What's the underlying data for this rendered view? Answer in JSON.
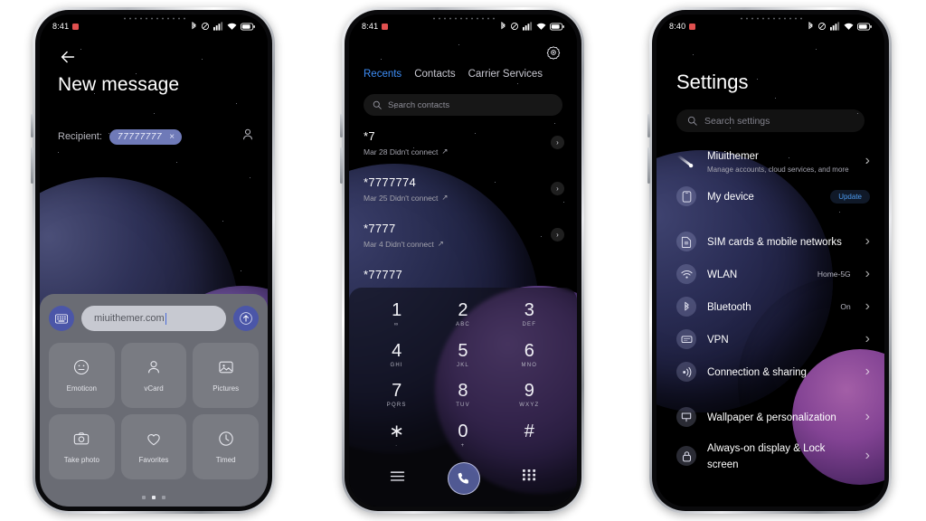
{
  "phones": [
    {
      "id": "new-message",
      "statusbar": {
        "time": "8:41",
        "icons": [
          "bluetooth-icon",
          "dnd-icon",
          "signal-icon",
          "wifi-icon",
          "battery-icon"
        ]
      },
      "screen": {
        "back_label": "Back",
        "title": "New message",
        "recipient_label": "Recipient:",
        "recipient_chip": "77777777",
        "chip_remove": "×",
        "contacts_icon": "person-icon",
        "composer": {
          "keyboard_icon": "keyboard-icon",
          "input_value": "miuithemer.com",
          "send_icon": "send-arrow-up-icon"
        },
        "attachments": [
          {
            "label": "Emoticon",
            "icon": "emoticon-icon"
          },
          {
            "label": "vCard",
            "icon": "person-icon"
          },
          {
            "label": "Pictures",
            "icon": "image-icon"
          },
          {
            "label": "Take photo",
            "icon": "camera-icon"
          },
          {
            "label": "Favorites",
            "icon": "heart-icon"
          },
          {
            "label": "Timed",
            "icon": "clock-icon"
          }
        ],
        "page_dots": {
          "count": 3,
          "active_index": 1
        }
      }
    },
    {
      "id": "dialer",
      "statusbar": {
        "time": "8:41",
        "icons": [
          "bluetooth-icon",
          "dnd-icon",
          "signal-icon",
          "wifi-icon",
          "battery-icon"
        ]
      },
      "screen": {
        "settings_icon": "gear-icon",
        "tabs": [
          {
            "label": "Recents",
            "active": true
          },
          {
            "label": "Contacts",
            "active": false
          },
          {
            "label": "Carrier Services",
            "active": false
          }
        ],
        "search_placeholder": "Search contacts",
        "search_icon": "search-icon",
        "calls": [
          {
            "number": "*7",
            "detail": "Mar 28 Didn't connect",
            "arrow": "↗"
          },
          {
            "number": "*7777774",
            "detail": "Mar 25 Didn't connect",
            "arrow": "↗"
          },
          {
            "number": "*7777",
            "detail": "Mar 4 Didn't connect",
            "arrow": "↗"
          },
          {
            "number": "*77777",
            "detail": "",
            "arrow": ""
          }
        ],
        "dialpad": [
          {
            "digit": "1",
            "letters": "∞"
          },
          {
            "digit": "2",
            "letters": "ABC"
          },
          {
            "digit": "3",
            "letters": "DEF"
          },
          {
            "digit": "4",
            "letters": "GHI"
          },
          {
            "digit": "5",
            "letters": "JKL"
          },
          {
            "digit": "6",
            "letters": "MNO"
          },
          {
            "digit": "7",
            "letters": "PQRS"
          },
          {
            "digit": "8",
            "letters": "TUV"
          },
          {
            "digit": "9",
            "letters": "WXYZ"
          },
          {
            "digit": "∗",
            "letters": "·"
          },
          {
            "digit": "0",
            "letters": "+"
          },
          {
            "digit": "#",
            "letters": ""
          }
        ],
        "bottombar": {
          "menu_icon": "hamburger-menu-icon",
          "call_icon": "phone-call-icon",
          "keypad_icon": "keypad-grid-icon"
        }
      }
    },
    {
      "id": "settings",
      "statusbar": {
        "time": "8:40",
        "icons": [
          "bluetooth-icon",
          "dnd-icon",
          "signal-icon",
          "wifi-icon",
          "battery-icon"
        ]
      },
      "screen": {
        "title": "Settings",
        "search_placeholder": "Search settings",
        "search_icon": "search-icon",
        "account": {
          "name": "Miuithemer",
          "description": "Manage accounts, cloud services, and more",
          "icon": "comet-icon"
        },
        "rows": [
          {
            "label": "My device",
            "value": "",
            "badge": "Update",
            "icon": "phone-device-icon",
            "chevron": false
          },
          {
            "label": "SIM cards & mobile networks",
            "value": "",
            "badge": "",
            "icon": "sim-card-icon",
            "chevron": true
          },
          {
            "label": "WLAN",
            "value": "Home-5G",
            "badge": "",
            "icon": "wifi-icon",
            "chevron": true
          },
          {
            "label": "Bluetooth",
            "value": "On",
            "badge": "",
            "icon": "bluetooth-icon",
            "chevron": true
          },
          {
            "label": "VPN",
            "value": "",
            "badge": "",
            "icon": "vpn-icon",
            "chevron": true
          },
          {
            "label": "Connection & sharing",
            "value": "",
            "badge": "",
            "icon": "connection-sharing-icon",
            "chevron": true
          },
          {
            "label": "Wallpaper & personalization",
            "value": "",
            "badge": "",
            "icon": "wallpaper-icon",
            "chevron": true
          },
          {
            "label": "Always-on display & Lock screen",
            "value": "",
            "badge": "",
            "icon": "lock-icon",
            "chevron": true
          }
        ]
      }
    }
  ],
  "colors": {
    "accent_blue": "#3e8ef7",
    "chip_blue": "#6f7ab8",
    "button_blue": "#4b56a8",
    "panel_gray": "#6a6c74",
    "badge_blue": "#4d9bf0"
  }
}
